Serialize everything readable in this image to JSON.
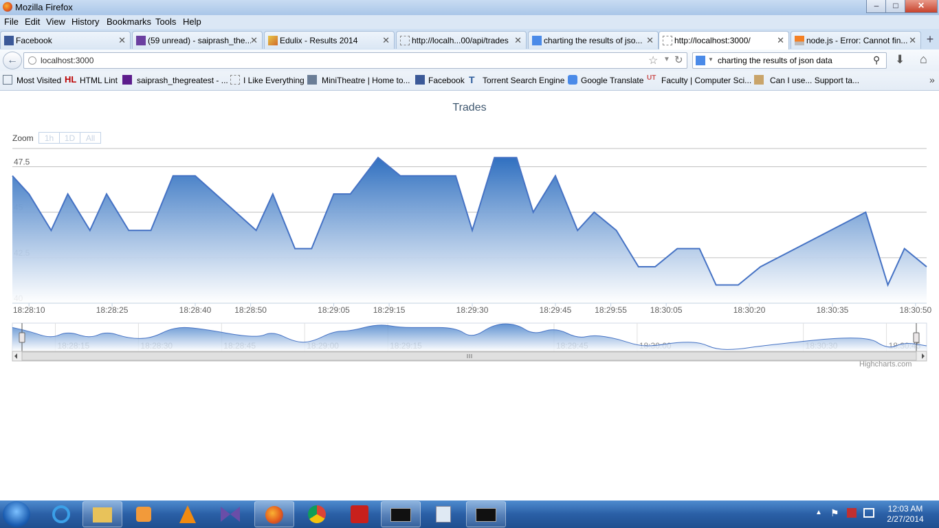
{
  "window": {
    "title": "Mozilla Firefox",
    "minimize": "–",
    "maximize": "□",
    "close": "✕"
  },
  "menu": [
    "File",
    "Edit",
    "View",
    "History",
    "Bookmarks",
    "Tools",
    "Help"
  ],
  "tabs": [
    {
      "label": "Facebook",
      "icon": "facebook-icon"
    },
    {
      "label": "(59 unread) - saiprash_the...",
      "icon": "mail-icon"
    },
    {
      "label": "Edulix - Results 2014",
      "icon": "pencil-icon"
    },
    {
      "label": "http://localh...00/api/trades",
      "icon": "page-icon"
    },
    {
      "label": "charting the results of jso...",
      "icon": "google-icon"
    },
    {
      "label": "http://localhost:3000/",
      "icon": "page-icon"
    },
    {
      "label": "node.js - Error: Cannot fin...",
      "icon": "stackoverflow-icon"
    }
  ],
  "nav": {
    "url": "localhost:3000",
    "search": "charting the results of json data"
  },
  "bookmarks": [
    {
      "label": "Most Visited"
    },
    {
      "label": "HTML Lint"
    },
    {
      "label": "saiprash_thegreatest - ..."
    },
    {
      "label": "I Like Everything"
    },
    {
      "label": "MiniTheatre | Home to..."
    },
    {
      "label": "Facebook"
    },
    {
      "label": "Torrent Search Engine"
    },
    {
      "label": "Google Translate"
    },
    {
      "label": "Faculty | Computer Sci..."
    },
    {
      "label": "Can I use... Support ta..."
    }
  ],
  "zoom": {
    "label": "Zoom",
    "buttons": [
      "1h",
      "1D",
      "All"
    ]
  },
  "credit": "Highcharts.com",
  "chart_data": {
    "type": "area",
    "title": "Trades",
    "ylim": [
      40,
      48.5
    ],
    "yticks": [
      40,
      42.5,
      45,
      47.5
    ],
    "xlim": [
      "18:28:07",
      "18:30:52"
    ],
    "xticks": [
      "18:28:10",
      "18:28:25",
      "18:28:40",
      "18:28:50",
      "18:29:05",
      "18:29:15",
      "18:29:30",
      "18:29:45",
      "18:29:55",
      "18:30:05",
      "18:30:20",
      "18:30:35",
      "18:30:50"
    ],
    "navigator_ticks": [
      "18:28:15",
      "18:28:30",
      "18:28:45",
      "18:29:00",
      "18:29:15",
      "18:29:45",
      "18:30:00",
      "18:30:30",
      "18:30:45"
    ],
    "x": [
      "18:28:07",
      "18:28:10",
      "18:28:14",
      "18:28:17",
      "18:28:21",
      "18:28:24",
      "18:28:28",
      "18:28:32",
      "18:28:36",
      "18:28:40",
      "18:28:51",
      "18:28:54",
      "18:28:58",
      "18:29:01",
      "18:29:05",
      "18:29:08",
      "18:29:13",
      "18:29:17",
      "18:29:21",
      "18:29:27",
      "18:29:30",
      "18:29:34",
      "18:29:38",
      "18:29:41",
      "18:29:45",
      "18:29:49",
      "18:29:52",
      "18:29:56",
      "18:30:00",
      "18:30:03",
      "18:30:07",
      "18:30:11",
      "18:30:14",
      "18:30:18",
      "18:30:22",
      "18:30:41",
      "18:30:45",
      "18:30:48",
      "18:30:52"
    ],
    "y": [
      47,
      46,
      44,
      46,
      44,
      46,
      44,
      44,
      47,
      47,
      44,
      46,
      43,
      43,
      46,
      46,
      48,
      47,
      47,
      47,
      44,
      48,
      48,
      45,
      47,
      44,
      45,
      44,
      42,
      42,
      43,
      43,
      41,
      41,
      42,
      45,
      41,
      43,
      42
    ]
  },
  "taskbar": {
    "time": "12:03 AM",
    "date": "2/27/2014"
  }
}
